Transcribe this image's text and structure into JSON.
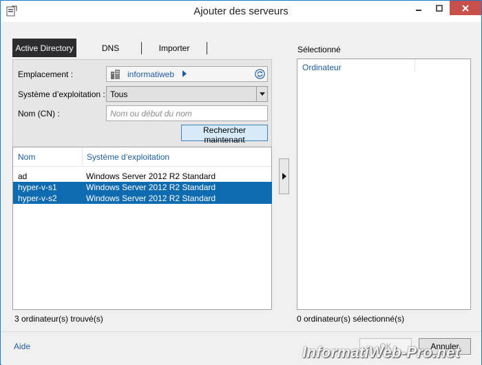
{
  "window": {
    "title": "Ajouter des serveurs"
  },
  "tabs": [
    {
      "label": "Active Directory",
      "active": true
    },
    {
      "label": "DNS",
      "active": false
    },
    {
      "label": "Importer",
      "active": false
    }
  ],
  "search": {
    "location_label": "Emplacement :",
    "location_value": "informatiweb",
    "os_label": "Système d’exploitation :",
    "os_value": "Tous",
    "name_label": "Nom (CN) :",
    "name_placeholder": "Nom ou début du nom",
    "name_value": "",
    "search_button": "Rechercher maintenant"
  },
  "results": {
    "columns": [
      "Nom",
      "Système d’exploitation"
    ],
    "rows": [
      {
        "name": "ad",
        "os": "Windows Server 2012 R2 Standard",
        "selected": false
      },
      {
        "name": "hyper-v-s1",
        "os": "Windows Server 2012 R2 Standard",
        "selected": true
      },
      {
        "name": "hyper-v-s2",
        "os": "Windows Server 2012 R2 Standard",
        "selected": true
      }
    ],
    "count_text": "3 ordinateur(s) trouvé(s)"
  },
  "selected": {
    "label": "Sélectionné",
    "column": "Ordinateur",
    "count_text": "0 ordinateur(s) sélectionné(s)"
  },
  "footer": {
    "help": "Aide",
    "ok": "OK",
    "cancel": "Annuler"
  },
  "watermark": "InformatiWeb-Pro.net",
  "colors": {
    "accent": "#0f6bb0",
    "link": "#1e5b9c",
    "close_button": "#c7504b",
    "active_tab": "#2d2d30"
  }
}
